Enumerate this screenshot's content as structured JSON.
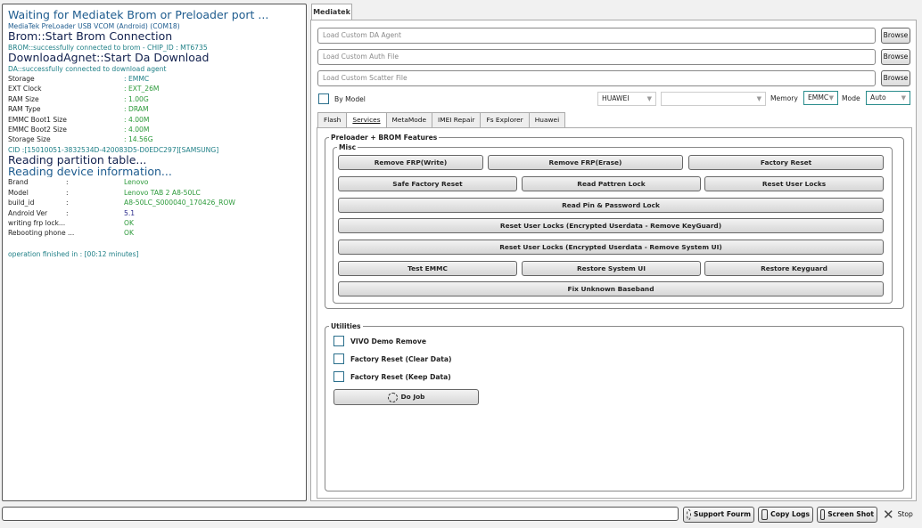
{
  "log": {
    "lines": [
      {
        "text": "Waiting for Mediatek Brom or Preloader port ...",
        "style": "big",
        "color": "blue"
      },
      {
        "text": "MediaTek PreLoader USB VCOM (Android) (COM18)",
        "style": "small",
        "color": "blue"
      },
      {
        "text": "Brom::Start Brom Connection",
        "style": "big",
        "color": "navy"
      },
      {
        "text": "BROM::successfully connected to brom - CHIP_ID : MT6735",
        "style": "small",
        "color": "teal"
      },
      {
        "text": "DownloadAgnet::Start Da Download",
        "style": "big",
        "color": "navy"
      },
      {
        "text": "DA::successfully connected to download agent",
        "style": "small",
        "color": "teal"
      }
    ],
    "specs": [
      {
        "key": "Storage",
        "value": ": EMMC"
      },
      {
        "key": "EXT Clock",
        "value": ": EXT_26M"
      },
      {
        "key": "RAM Size",
        "value": ": 1.00G"
      },
      {
        "key": "RAM Type",
        "value": ": DRAM"
      },
      {
        "key": "EMMC Boot1 Size",
        "value": ": 4.00M"
      },
      {
        "key": "EMMC Boot2 Size",
        "value": ": 4.00M"
      },
      {
        "key": "Storage Size",
        "value": ": 14.56G"
      }
    ],
    "cid": "CID :[15010051-3832534D-420083D5-D0EDC297][SAMSUNG]",
    "reading_partition": "Reading partition table...",
    "reading_device": "Reading device information...",
    "device": [
      {
        "key": "Brand",
        "colon": ":",
        "value": "Lenovo",
        "color": "green"
      },
      {
        "key": "Model",
        "colon": ":",
        "value": "Lenovo TAB 2 A8-50LC",
        "color": "green"
      },
      {
        "key": "build_id",
        "colon": ":",
        "value": "A8-50LC_S000040_170426_ROW",
        "color": "green"
      },
      {
        "key": "Android Ver",
        "colon": ":",
        "value": "5.1",
        "color": "purple"
      },
      {
        "key": "writing frp lock...",
        "colon": "",
        "value": "OK",
        "color": "green"
      },
      {
        "key": "Rebooting phone ...",
        "colon": "",
        "value": "OK",
        "color": "green"
      }
    ],
    "finished": "operation finished in : [00:12 minutes]"
  },
  "top_tab": "Mediatek",
  "loaders": [
    {
      "placeholder": "Load Custom DA Agent",
      "button": "Browse"
    },
    {
      "placeholder": "Load Custom Auth File",
      "button": "Browse"
    },
    {
      "placeholder": "Load Custom Scatter File",
      "button": "Browse"
    }
  ],
  "options": {
    "by_model_label": "By Model",
    "brand": "HUAWEI",
    "model": "",
    "memory_label": "Memory",
    "memory": "EMMC",
    "mode_label": "Mode",
    "mode": "Auto"
  },
  "subtabs": [
    "Flash",
    "Services",
    "MetaMode",
    "IMEI Repair",
    "Fs Explorer",
    "Huawei"
  ],
  "active_subtab": "Services",
  "preloader_group": "Preloader + BROM Features",
  "misc_group": "Misc",
  "misc_buttons": {
    "remove_frp_write": "Remove FRP(Write)",
    "remove_frp_erase": "Remove FRP(Erase)",
    "factory_reset": "Factory Reset",
    "safe_factory_reset": "Safe Factory Reset",
    "read_pattren_lock": "Read Pattren Lock",
    "reset_user_locks": "Reset User Locks",
    "read_pin_password": "Read Pin & Password Lock",
    "reset_remove_keyguard": "Reset User Locks (Encrypted Userdata - Remove KeyGuard)",
    "reset_remove_system_ui": "Reset User Locks (Encrypted Userdata - Remove System UI)",
    "test_emmc": "Test EMMC",
    "restore_system_ui": "Restore System UI",
    "restore_keyguard": "Restore Keyguard",
    "fix_unknown_baseband": "Fix Unknown Baseband"
  },
  "utilities_group": "Utilities",
  "utilities": [
    "VIVO Demo Remove",
    "Factory Reset (Clear Data)",
    "Factory Reset (Keep Data)"
  ],
  "do_job": "Do Job",
  "bottom": {
    "support": "Support Fourm",
    "copy_logs": "Copy Logs",
    "screenshot": "Screen Shot",
    "stop": "Stop"
  },
  "colors": {
    "blue": "#1d5b8e",
    "navy": "#12214e",
    "teal": "#1e7f86",
    "green": "#2c9a3a",
    "purple": "#2a2a8a"
  }
}
